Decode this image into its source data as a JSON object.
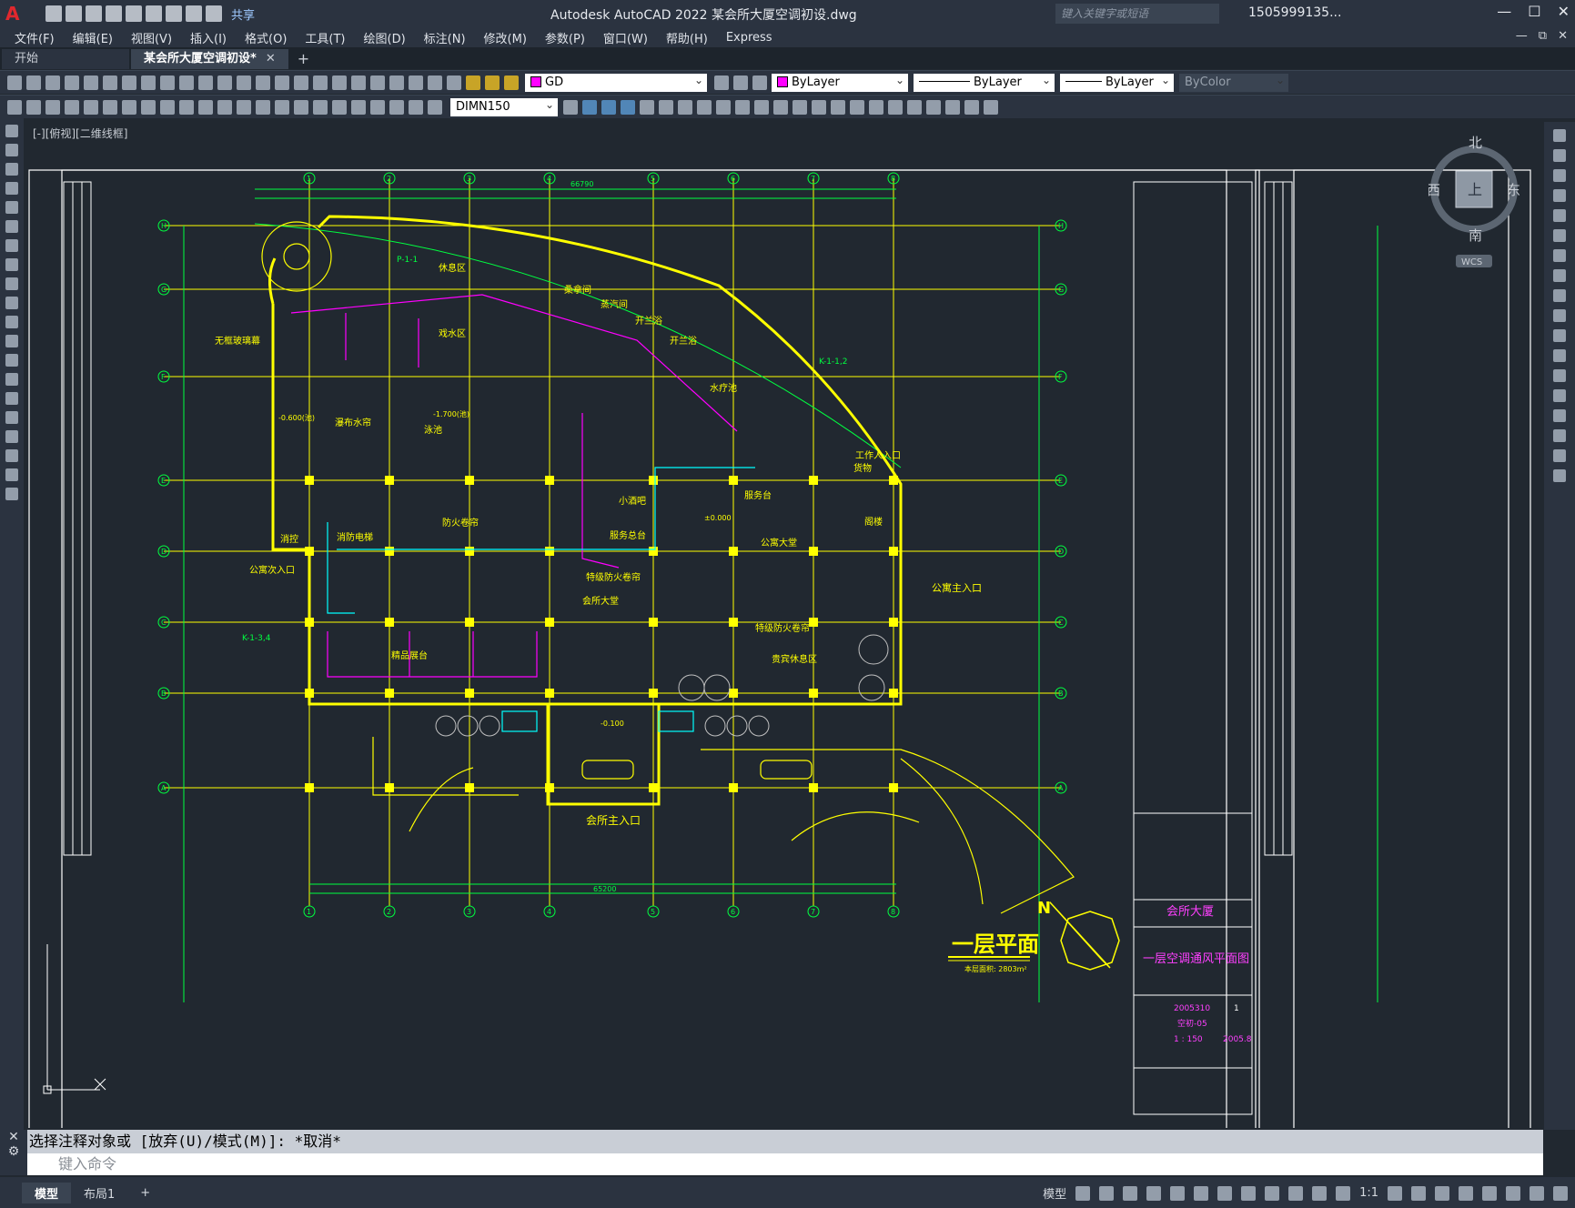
{
  "titlebar": {
    "logo": "A",
    "share_label": "共享",
    "title": "Autodesk AutoCAD 2022    某会所大厦空调初设.dwg",
    "search_placeholder": "键入关键字或短语",
    "user": "1505999135...",
    "controls": [
      "—",
      "☐",
      "✕"
    ]
  },
  "menubar": {
    "items": [
      "文件(F)",
      "编辑(E)",
      "视图(V)",
      "插入(I)",
      "格式(O)",
      "工具(T)",
      "绘图(D)",
      "标注(N)",
      "修改(M)",
      "参数(P)",
      "窗口(W)",
      "帮助(H)",
      "Express"
    ],
    "mdi_controls": [
      "—",
      "⧉",
      "✕"
    ]
  },
  "tabs": {
    "start": "开始",
    "file": "某会所大厦空调初设*",
    "close": "✕",
    "add": "+"
  },
  "properties": {
    "layer": "GD",
    "color": "ByLayer",
    "linetype": "ByLayer",
    "lineweight": "ByLayer",
    "plotstyle": "ByColor",
    "dimstyle": "DIMN150",
    "layer_color": "#ff00ff"
  },
  "viewport": {
    "label": "[-][俯视][二维线框]",
    "viewcube": {
      "north": "北",
      "south": "南",
      "east": "东",
      "west": "西",
      "face": "上",
      "wcs": "WCS"
    }
  },
  "drawing": {
    "title": "一层平面",
    "area_note": "本层面积: 2803m²",
    "main_entrance": "会所主入口",
    "apartment_entrance": "公寓主入口",
    "apartment_side_entrance": "公寓次入口",
    "project_name": "会所大厦",
    "sheet_title": "一层空调通风平面图",
    "sheet_no": "空初-05",
    "scale": "1 : 150",
    "date": "2005.8",
    "job_no": "2005310",
    "page": "1",
    "total_dim": "66790",
    "bottom_dim": "65200",
    "grid_cols": [
      "1",
      "2",
      "3",
      "4",
      "5",
      "6",
      "7",
      "8"
    ],
    "grid_rows": [
      "A",
      "B",
      "C",
      "D",
      "E",
      "F",
      "G",
      "H"
    ],
    "rooms": [
      "休息区",
      "桑拿间",
      "蒸汽间",
      "开兰浴",
      "开兰浴",
      "水疗池",
      "无框玻璃幕",
      "戏水区",
      "瀑布水帘",
      "泳池",
      "消控",
      "消防电梯",
      "防火卷帘",
      "小酒吧",
      "服务台",
      "阁楼",
      "服务总台",
      "公寓大堂",
      "会所大堂",
      "精品展台",
      "特级防火卷帘",
      "特级防火卷帘",
      "贵宾休息区",
      "货物",
      "工作人入口"
    ],
    "annotations": [
      "P-1-1",
      "K-1-1,2",
      "K-1-3,4",
      "-0.600(池)",
      "-1.700(池)",
      "±0.000",
      "-0.100"
    ]
  },
  "command": {
    "history": "选择注释对象或 [放弃(U)/模式(M)]: *取消*",
    "placeholder": "键入命令"
  },
  "status": {
    "layouts": [
      "模型",
      "布局1"
    ],
    "add": "+",
    "model_btn": "模型",
    "scale": "1:1"
  }
}
